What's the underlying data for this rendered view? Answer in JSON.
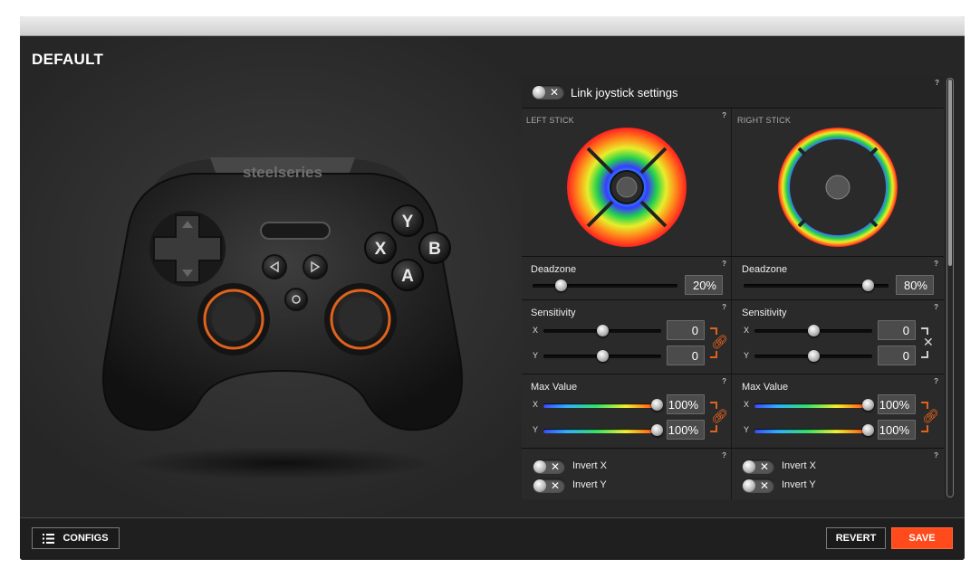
{
  "config": {
    "title": "DEFAULT"
  },
  "controller": {
    "brand": "steelseries",
    "buttons": {
      "y": "Y",
      "x": "X",
      "b": "B",
      "a": "A"
    }
  },
  "panel": {
    "link_label": "Link joystick settings",
    "left": {
      "title": "LEFT STICK",
      "deadzone": {
        "label": "Deadzone",
        "value": "20%",
        "level": 0.2
      },
      "sensitivity": {
        "label": "Sensitivity",
        "x_label": "X",
        "y_label": "Y",
        "x_value": "0",
        "y_value": "0"
      },
      "max_value": {
        "label": "Max Value",
        "x_label": "X",
        "y_label": "Y",
        "x_value": "100%",
        "y_value": "100%"
      },
      "invert_x": "Invert X",
      "invert_y": "Invert Y"
    },
    "right": {
      "title": "RIGHT STICK",
      "deadzone": {
        "label": "Deadzone",
        "value": "80%",
        "level": 0.8
      },
      "sensitivity": {
        "label": "Sensitivity",
        "x_label": "X",
        "y_label": "Y",
        "x_value": "0",
        "y_value": "0"
      },
      "max_value": {
        "label": "Max Value",
        "x_label": "X",
        "y_label": "Y",
        "x_value": "100%",
        "y_value": "100%"
      },
      "invert_x": "Invert X",
      "invert_y": "Invert Y"
    },
    "help_mark": "?",
    "toggle_off_mark": "✕"
  },
  "footer": {
    "configs_label": "CONFIGS",
    "revert_label": "REVERT",
    "save_label": "SAVE"
  },
  "colors": {
    "accent": "#ff4b1c",
    "link": "#e0621c"
  },
  "icons": {
    "configs": "list-icon",
    "link": "chain-link-icon",
    "unlink": "x-icon"
  }
}
